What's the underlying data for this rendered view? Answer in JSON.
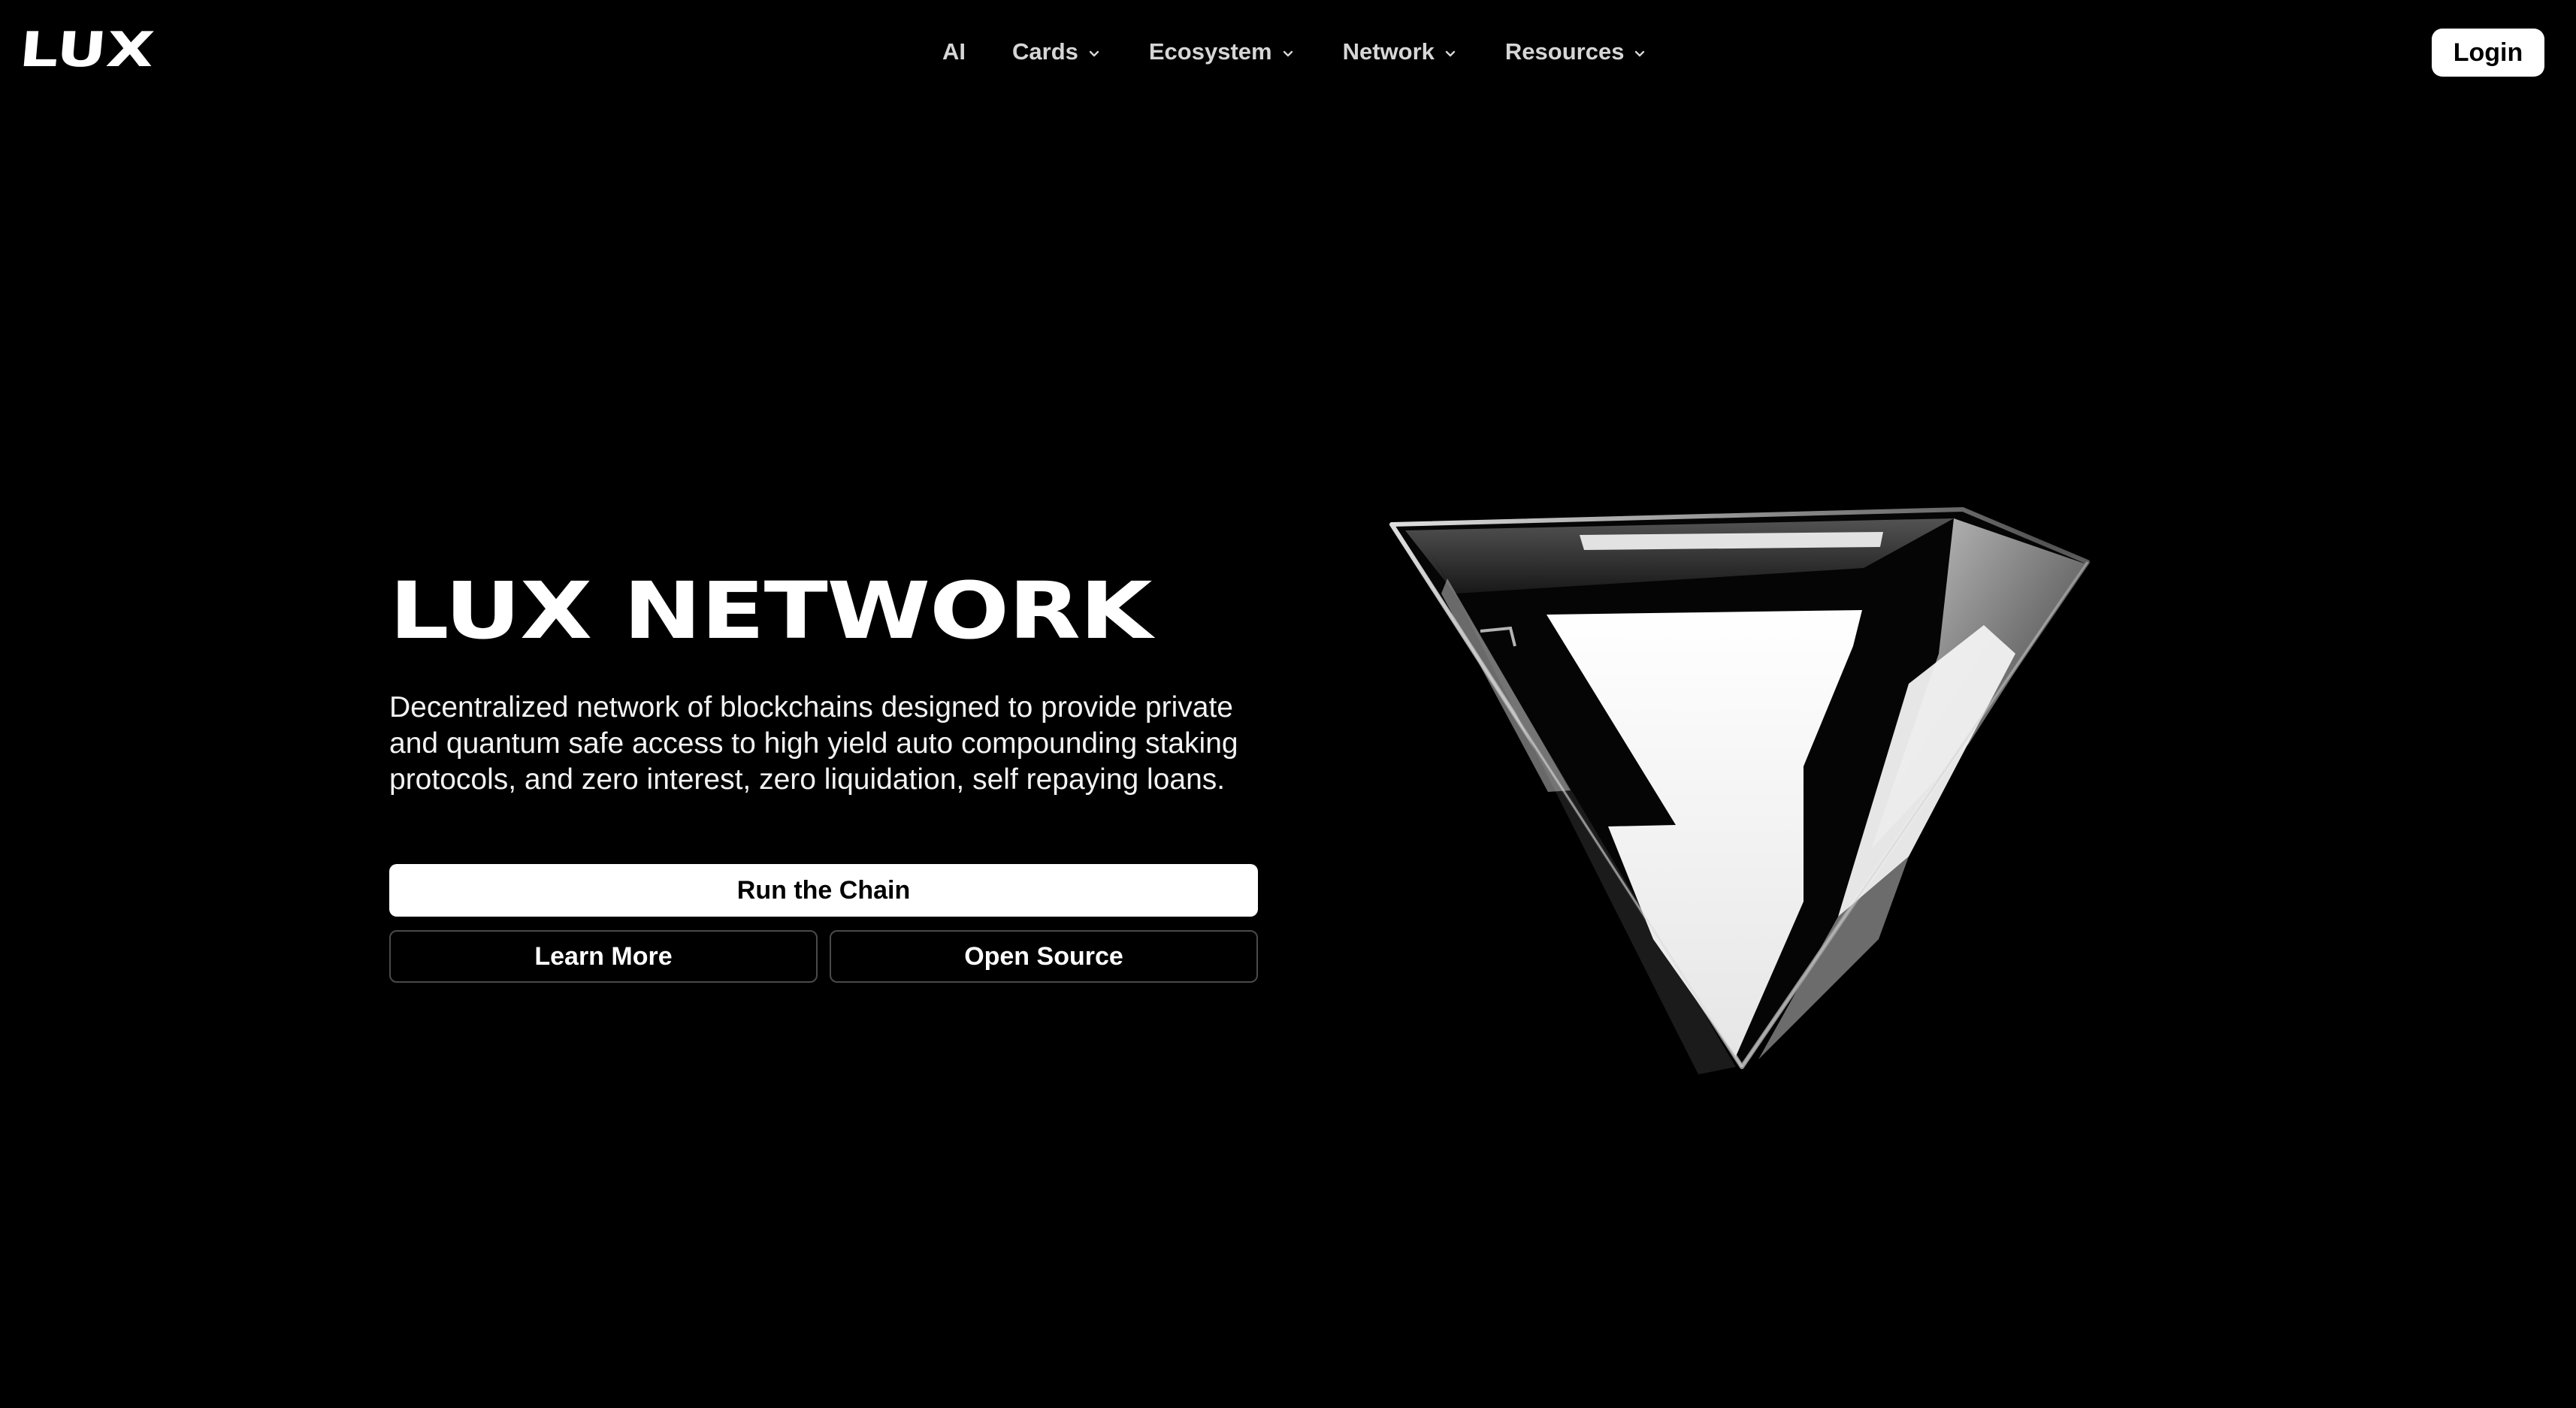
{
  "header": {
    "logo_text": "LUX",
    "nav": [
      {
        "label": "AI",
        "has_dropdown": false
      },
      {
        "label": "Cards",
        "has_dropdown": true
      },
      {
        "label": "Ecosystem",
        "has_dropdown": true
      },
      {
        "label": "Network",
        "has_dropdown": true
      },
      {
        "label": "Resources",
        "has_dropdown": true
      }
    ],
    "login_label": "Login"
  },
  "hero": {
    "title": "LUX NETWORK",
    "description": "Decentralized network of blockchains designed to provide private and quantum safe access to high yield auto compounding staking protocols, and zero interest, zero liquidation, self repaying loans.",
    "primary_button": "Run the Chain",
    "secondary_buttons": [
      "Learn More",
      "Open Source"
    ]
  },
  "artwork": {
    "icon": "glass-triangle-logo-icon"
  },
  "colors": {
    "background": "#000000",
    "text": "#ffffff",
    "nav_text": "#d6d6d6",
    "button_primary_bg": "#ffffff",
    "button_primary_text": "#000000",
    "button_outline_border": "#4a4a4a"
  }
}
